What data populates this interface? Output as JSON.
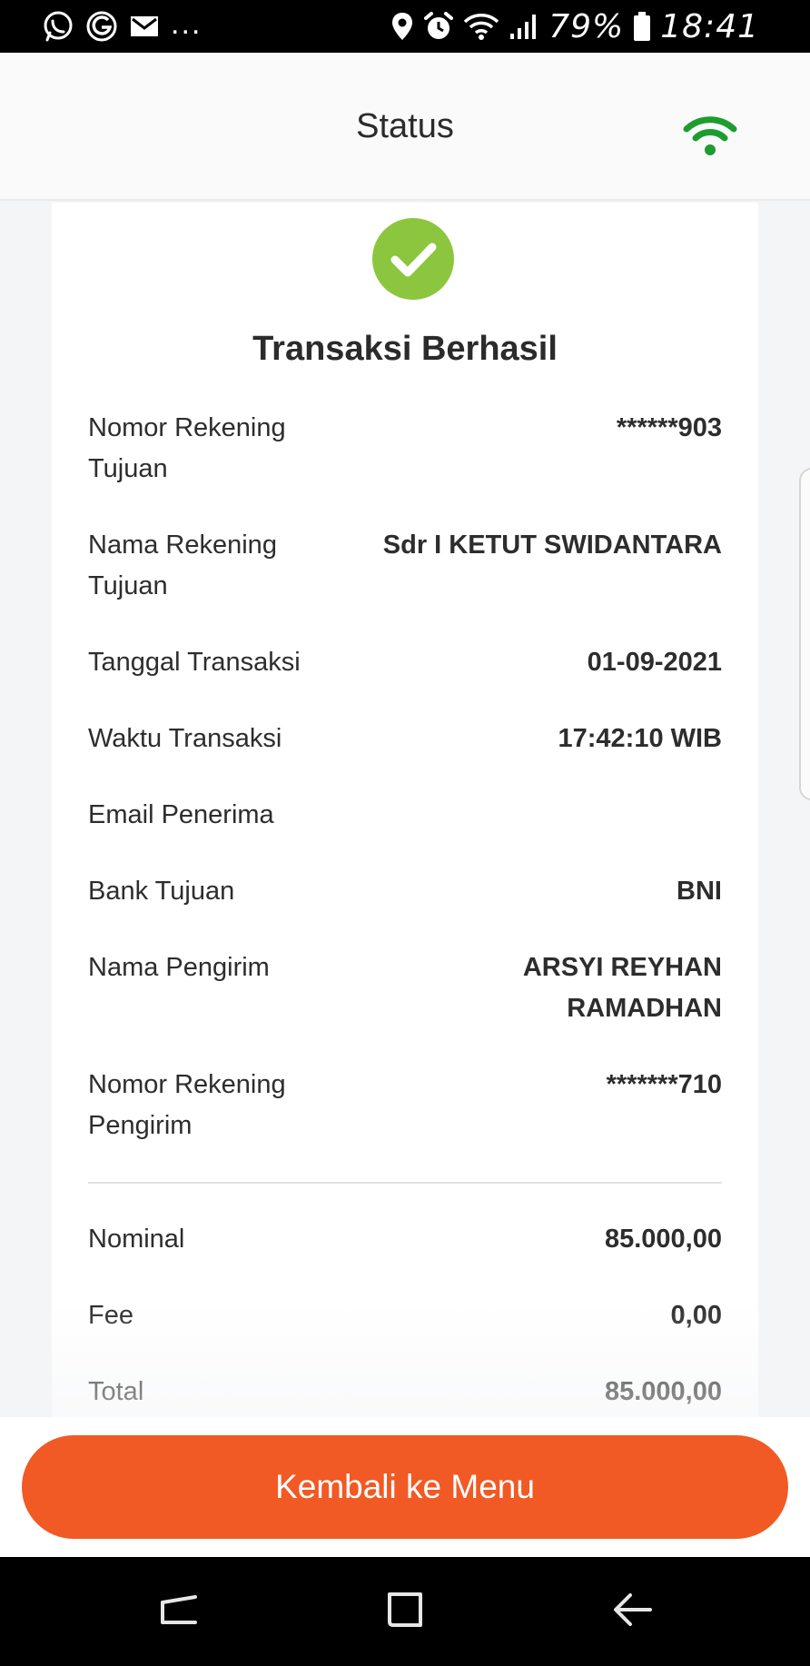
{
  "status_bar": {
    "left_icons": [
      "whatsapp-icon",
      "g-icon",
      "mail-icon"
    ],
    "overflow": "...",
    "right_icons": [
      "location-icon",
      "alarm-icon",
      "wifi-icon",
      "cell-signal-icon"
    ],
    "battery_percent": "79%",
    "time": "18:41"
  },
  "header": {
    "title": "Status",
    "connection_icon": "wifi-icon",
    "connection_color": "#1e9c2f"
  },
  "result": {
    "icon": "check-circle-icon",
    "icon_color": "#8cc63f",
    "title": "Transaksi Berhasil"
  },
  "details": [
    {
      "label": "Nomor Rekening Tujuan",
      "value": "******903"
    },
    {
      "label": "Nama Rekening Tujuan",
      "value": "Sdr I KETUT SWIDANTARA"
    },
    {
      "label": "Tanggal Transaksi",
      "value": "01-09-2021"
    },
    {
      "label": "Waktu Transaksi",
      "value": "17:42:10 WIB"
    },
    {
      "label": "Email Penerima",
      "value": ""
    },
    {
      "label": "Bank Tujuan",
      "value": "BNI"
    },
    {
      "label": "Nama Pengirim",
      "value": "ARSYI REYHAN RAMADHAN"
    },
    {
      "label": "Nomor Rekening Pengirim",
      "value": "*******710"
    }
  ],
  "summary": [
    {
      "label": "Nominal",
      "value": "85.000,00"
    },
    {
      "label": "Fee",
      "value": "0,00"
    },
    {
      "label": "Total",
      "value": "85.000,00"
    }
  ],
  "actions": {
    "back_to_menu": "Kembali ke Menu",
    "button_color": "#f15a24"
  },
  "nav_bar": {
    "buttons": [
      "recent-apps-icon",
      "home-icon",
      "back-icon"
    ]
  }
}
